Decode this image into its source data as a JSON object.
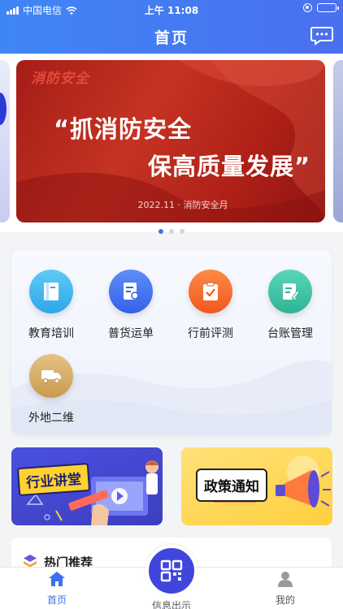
{
  "status_bar": {
    "carrier": "中国电信",
    "time": "上午 11:08"
  },
  "header": {
    "title": "首页"
  },
  "banner": {
    "tag": "消防安全",
    "line1": "“抓消防安全",
    "line2": "保高质量发展”",
    "subtitle": "2022.11 · 消防安全月",
    "dots": 3,
    "active_dot": 0
  },
  "functions": [
    {
      "label": "教育培训",
      "icon": "book-icon",
      "color": "#3db6ee"
    },
    {
      "label": "普货运单",
      "icon": "waybill-icon",
      "color": "#3f72ee"
    },
    {
      "label": "行前评测",
      "icon": "clipboard-check-icon",
      "color": "#f66a2e"
    },
    {
      "label": "台账管理",
      "icon": "ledger-edit-icon",
      "color": "#3cc2a6"
    },
    {
      "label": "外地二维",
      "icon": "truck-icon",
      "color": "#d8b06a"
    }
  ],
  "promos": {
    "left_title": "行业讲堂",
    "right_title": "政策通知"
  },
  "hot": {
    "title": "热门推荐"
  },
  "tabbar": {
    "items": [
      {
        "label": "首页",
        "icon": "home-icon",
        "active": true
      },
      {
        "label": "信息出示",
        "icon": "qrcode-icon",
        "active": false
      },
      {
        "label": "我的",
        "icon": "user-icon",
        "active": false
      }
    ],
    "active_color": "#3d6ff0",
    "inactive_color": "#555555"
  }
}
